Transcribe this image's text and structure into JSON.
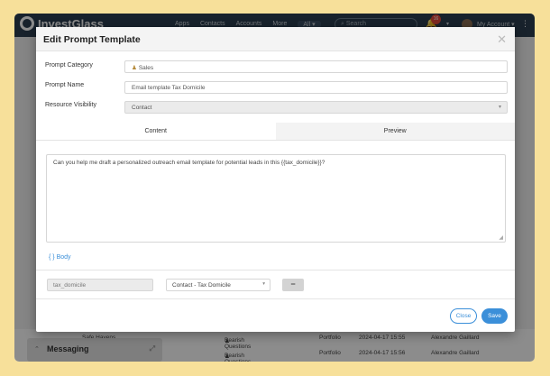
{
  "app": {
    "logo_text": "InvestGlass",
    "nav": [
      "Apps",
      "Contacts",
      "Accounts",
      "More",
      "All ▾"
    ],
    "search_placeholder": "Search",
    "notification_count": "16",
    "account_label": "My Account ▾"
  },
  "background": {
    "rows": [
      {
        "name": "Safe Havens",
        "question": "Bearish Questions",
        "type": "Portfolio",
        "date": "2024-04-17 15:55",
        "owner": "Alexandre Gaillard"
      },
      {
        "name": "",
        "question": "Bearish Questions",
        "type": "Portfolio",
        "date": "2024-04-17 15:56",
        "owner": "Alexandre Gaillard"
      }
    ],
    "messaging_label": "Messaging"
  },
  "modal": {
    "title": "Edit Prompt Template",
    "close_symbol": "✕",
    "fields": {
      "category_label": "Prompt Category",
      "category_value": "Sales",
      "name_label": "Prompt Name",
      "name_value": "Email template Tax Domicile",
      "visibility_label": "Resource Visibility",
      "visibility_value": "Contact"
    },
    "tabs": {
      "content": "Content",
      "preview": "Preview"
    },
    "editor_text": "Can you help me draft a personalized outreach email template for potential leads in this {{tax_domicile}}?",
    "body_link": "{ } Body",
    "variable": {
      "name": "tax_domicile",
      "source": "Contact - Tax Domicile",
      "remove_symbol": "−"
    },
    "buttons": {
      "close": "Close",
      "save": "Save"
    }
  }
}
